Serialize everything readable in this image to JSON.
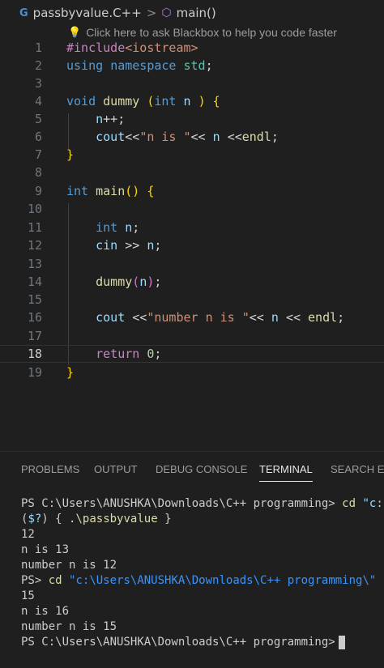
{
  "breadcrumb": {
    "file_icon": "cpp-file-icon",
    "file_name": "passbyvalue.C++",
    "separator": ">",
    "symbol_icon": "cube-icon",
    "symbol_name": "main()"
  },
  "hint": {
    "icon": "lightbulb-icon",
    "text": "Click here to ask Blackbox to help you code faster"
  },
  "editor": {
    "active_line": 18,
    "line_numbers": [
      "1",
      "2",
      "3",
      "4",
      "5",
      "6",
      "7",
      "8",
      "9",
      "10",
      "11",
      "12",
      "13",
      "14",
      "15",
      "16",
      "17",
      "18",
      "19"
    ],
    "code": {
      "l1_include": "#include",
      "l1_header": "<iostream>",
      "l2_using": "using",
      "l2_namespace": "namespace",
      "l2_std": "std",
      "l2_semi": ";",
      "l4_void": "void",
      "l4_fn": "dummy",
      "l4_paren_open": "(",
      "l4_int": "int",
      "l4_n": "n",
      "l4_paren_close": ")",
      "l4_brace": "{",
      "l5_n": "n",
      "l5_rest": "++;",
      "l6_cout": "cout",
      "l6_op1": "<<",
      "l6_str": "\"n is \"",
      "l6_op2": "<<",
      "l6_n": "n",
      "l6_op3": "<<",
      "l6_endl": "endl",
      "l6_semi": ";",
      "l7_brace": "}",
      "l9_int": "int",
      "l9_main": "main",
      "l9_parens": "()",
      "l9_brace": "{",
      "l11_int": "int",
      "l11_n": "n",
      "l11_semi": ";",
      "l12_cin": "cin",
      "l12_op": ">>",
      "l12_n": "n",
      "l12_semi": ";",
      "l14_fn": "dummy",
      "l14_open": "(",
      "l14_n": "n",
      "l14_close": ")",
      "l14_semi": ";",
      "l16_cout": "cout",
      "l16_op1": "<<",
      "l16_str": "\"number n is \"",
      "l16_op2": "<<",
      "l16_n": "n",
      "l16_op3": "<<",
      "l16_endl": "endl",
      "l16_semi": ";",
      "l18_return": "return",
      "l18_zero": "0",
      "l18_semi": ";",
      "l19_brace": "}"
    }
  },
  "panel": {
    "tabs": [
      "PROBLEMS",
      "OUTPUT",
      "DEBUG CONSOLE",
      "TERMINAL",
      "SEARCH ER"
    ],
    "active_tab": "TERMINAL"
  },
  "terminal": {
    "l1_prompt": "PS C:\\Users\\ANUSHKA\\Downloads\\C++ programming>",
    "l1_cmd": "cd",
    "l1_arg": "\"c:",
    "l2_a": "(",
    "l2_b": "$?",
    "l2_c": ")",
    "l2_d": "{",
    "l2_e": ".\\passbyvalue",
    "l2_f": "}",
    "l3": "12",
    "l4": "n is 13",
    "l5": "number n is 12",
    "l6_prompt": "PS>",
    "l6_cmd": "cd",
    "l6_arg": "\"c:\\Users\\ANUSHKA\\Downloads\\C++ programming\\\"",
    "l7": "15",
    "l8": "n is 16",
    "l9": "number n is 15",
    "l10_prompt": "PS C:\\Users\\ANUSHKA\\Downloads\\C++ programming>"
  },
  "colors": {
    "background": "#1f1f1f",
    "keyword": "#569cd6",
    "control": "#c586c0",
    "function": "#dcdcaa",
    "string": "#ce9178",
    "number": "#b5cea8",
    "variable": "#9cdcfe",
    "type": "#4ec9b0"
  }
}
